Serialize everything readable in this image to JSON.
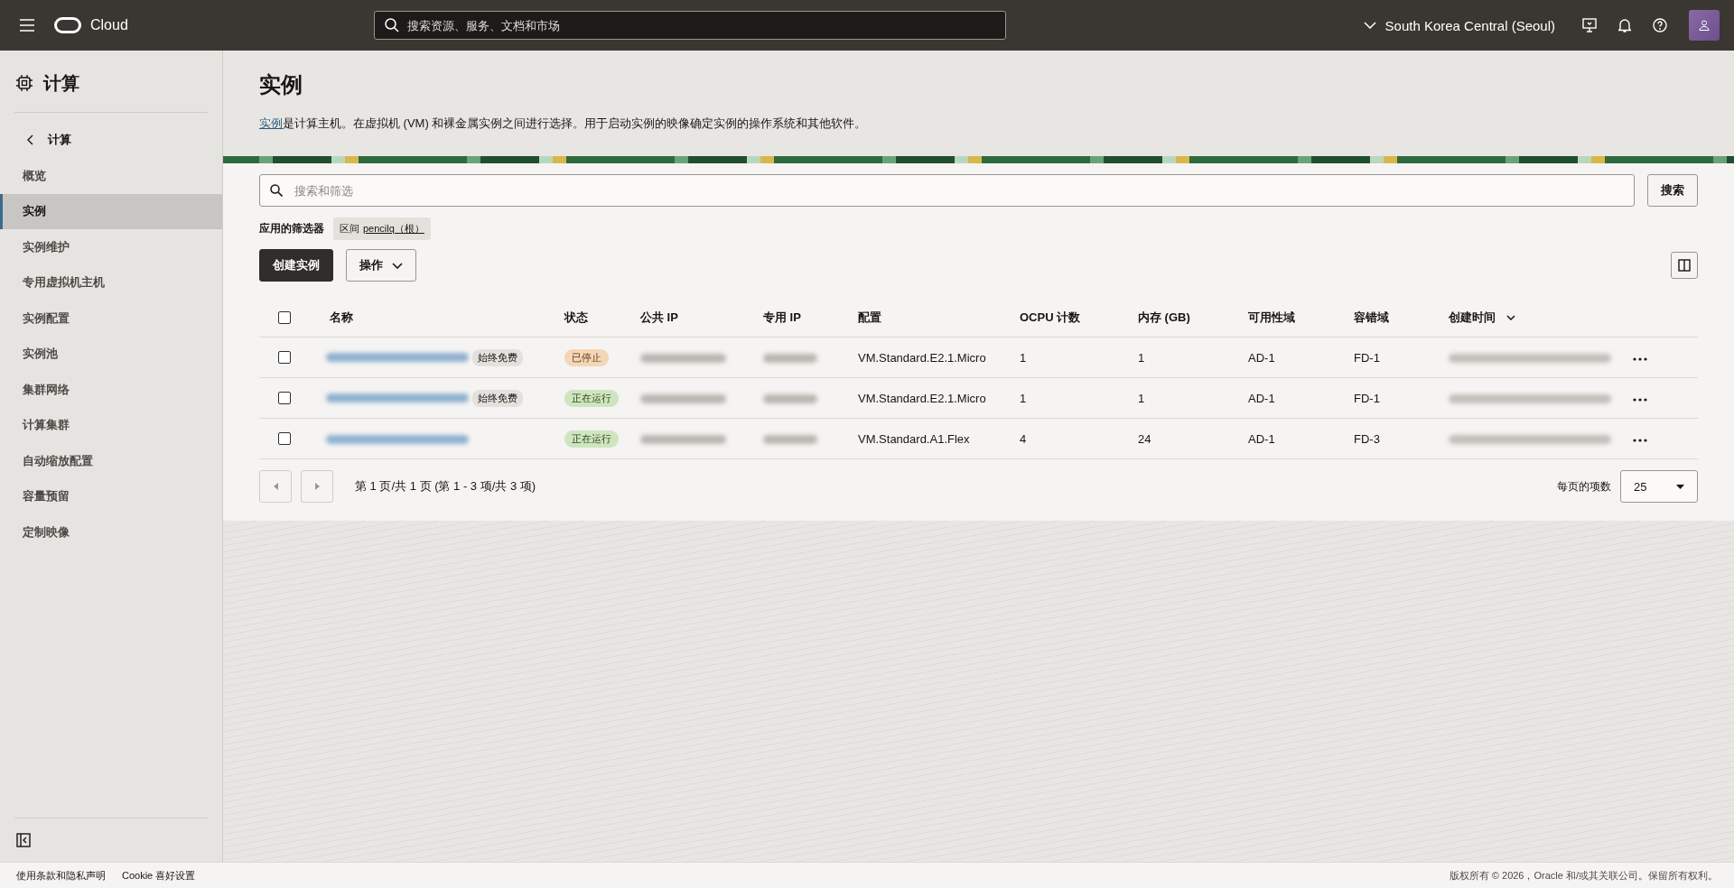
{
  "header": {
    "brand": "Cloud",
    "search_placeholder": "搜索资源、服务、文档和市场",
    "region": "South Korea Central (Seoul)"
  },
  "sidebar": {
    "title": "计算",
    "back": "计算",
    "items": [
      {
        "label": "概览",
        "selected": false
      },
      {
        "label": "实例",
        "selected": true
      },
      {
        "label": "实例维护",
        "selected": false
      },
      {
        "label": "专用虚拟机主机",
        "selected": false
      },
      {
        "label": "实例配置",
        "selected": false
      },
      {
        "label": "实例池",
        "selected": false
      },
      {
        "label": "集群网络",
        "selected": false
      },
      {
        "label": "计算集群",
        "selected": false
      },
      {
        "label": "自动缩放配置",
        "selected": false
      },
      {
        "label": "容量预留",
        "selected": false
      },
      {
        "label": "定制映像",
        "selected": false
      }
    ]
  },
  "page": {
    "title": "实例",
    "description_link": "实例",
    "description": "是计算主机。在虚拟机 (VM) 和裸金属实例之间进行选择。用于启动实例的映像确定实例的操作系统和其他软件。",
    "search_placeholder": "搜索和筛选",
    "search_button": "搜索",
    "filters_label": "应用的筛选器",
    "filter_chip": {
      "prefix": "区间",
      "value": "pencilq（根）"
    },
    "create_button": "创建实例",
    "actions_button": "操作"
  },
  "table": {
    "select_all_checked": false,
    "columns": [
      {
        "label": "名称",
        "sorted": false
      },
      {
        "label": "状态",
        "sorted": false
      },
      {
        "label": "公共 IP",
        "sorted": false
      },
      {
        "label": "专用 IP",
        "sorted": false
      },
      {
        "label": "配置",
        "sorted": false
      },
      {
        "label": "OCPU 计数",
        "sorted": false
      },
      {
        "label": "内存 (GB)",
        "sorted": false
      },
      {
        "label": "可用性域",
        "sorted": false
      },
      {
        "label": "容错域",
        "sorted": false
      },
      {
        "label": "创建时间",
        "sorted": true
      }
    ],
    "rows": [
      {
        "checked": false,
        "badge": "始终免费",
        "status": {
          "kind": "stopped",
          "label": "已停止"
        },
        "shape": "VM.Standard.E2.1.Micro",
        "ocpu": "1",
        "memory": "1",
        "ad": "AD-1",
        "fd": "FD-1"
      },
      {
        "checked": false,
        "badge": "始终免费",
        "status": {
          "kind": "running",
          "label": "正在运行"
        },
        "shape": "VM.Standard.E2.1.Micro",
        "ocpu": "1",
        "memory": "1",
        "ad": "AD-1",
        "fd": "FD-1"
      },
      {
        "checked": false,
        "status": {
          "kind": "running",
          "label": "正在运行"
        },
        "shape": "VM.Standard.A1.Flex",
        "ocpu": "4",
        "memory": "24",
        "ad": "AD-1",
        "fd": "FD-3"
      }
    ]
  },
  "pagination": {
    "summary": "第 1 页/共 1 页 (第 1 - 3 项/共 3 项)",
    "per_page_label": "每页的项数",
    "per_page": "25"
  },
  "footer": {
    "links": [
      "使用条款和隐私声明",
      "Cookie 喜好设置"
    ],
    "copyright": "版权所有 © 2026，Oracle 和/或其关联公司。保留所有权利。"
  }
}
